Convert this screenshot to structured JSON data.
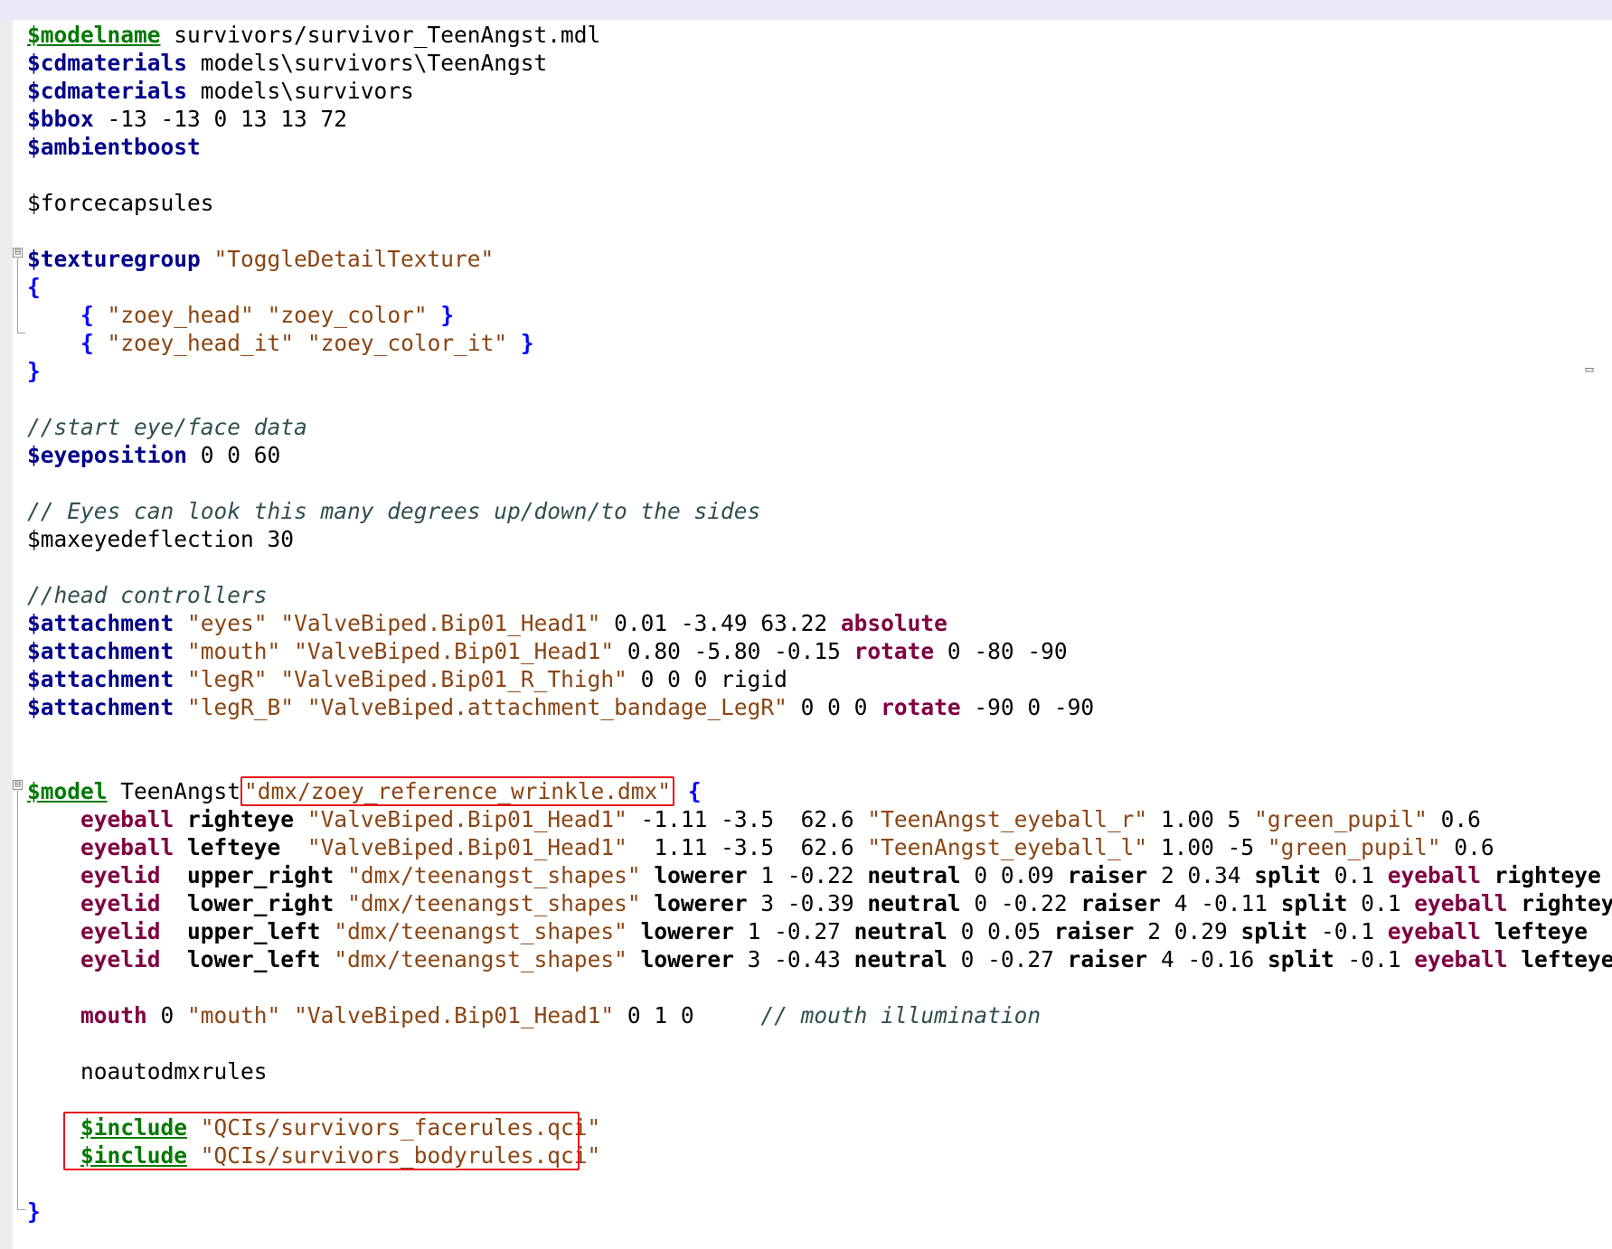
{
  "editor": {
    "lines": [
      [
        {
          "t": "$modelname",
          "c": "kwg"
        },
        {
          "t": " survivors/survivor_TeenAngst.mdl",
          "c": "plain"
        }
      ],
      [
        {
          "t": "$cdmaterials",
          "c": "kw"
        },
        {
          "t": " models\\survivors\\TeenAngst",
          "c": "plain"
        }
      ],
      [
        {
          "t": "$cdmaterials",
          "c": "kw"
        },
        {
          "t": " models\\survivors",
          "c": "plain"
        }
      ],
      [
        {
          "t": "$bbox",
          "c": "kw"
        },
        {
          "t": " -13 -13 0 13 13 72",
          "c": "plain"
        }
      ],
      [
        {
          "t": "$ambientboost",
          "c": "kw"
        }
      ],
      [],
      [
        {
          "t": "$forcecapsules",
          "c": "plain"
        }
      ],
      [],
      [
        {
          "t": "$texturegroup",
          "c": "kw"
        },
        {
          "t": " ",
          "c": "plain"
        },
        {
          "t": "\"ToggleDetailTexture\"",
          "c": "str"
        }
      ],
      [
        {
          "t": "{",
          "c": "br"
        }
      ],
      [
        {
          "t": "    ",
          "c": "plain"
        },
        {
          "t": "{",
          "c": "br"
        },
        {
          "t": " ",
          "c": "plain"
        },
        {
          "t": "\"zoey_head\"",
          "c": "str"
        },
        {
          "t": " ",
          "c": "plain"
        },
        {
          "t": "\"zoey_color\"",
          "c": "str"
        },
        {
          "t": " ",
          "c": "plain"
        },
        {
          "t": "}",
          "c": "br"
        }
      ],
      [
        {
          "t": "    ",
          "c": "plain"
        },
        {
          "t": "{",
          "c": "br"
        },
        {
          "t": " ",
          "c": "plain"
        },
        {
          "t": "\"zoey_head_it\"",
          "c": "str"
        },
        {
          "t": " ",
          "c": "plain"
        },
        {
          "t": "\"zoey_color_it\"",
          "c": "str"
        },
        {
          "t": " ",
          "c": "plain"
        },
        {
          "t": "}",
          "c": "br"
        }
      ],
      [
        {
          "t": "}",
          "c": "br"
        }
      ],
      [],
      [
        {
          "t": "//start eye/face data",
          "c": "cm"
        }
      ],
      [
        {
          "t": "$eyeposition",
          "c": "kw"
        },
        {
          "t": " 0 0 60",
          "c": "plain"
        }
      ],
      [],
      [
        {
          "t": "// Eyes can look this many degrees up/down/to the sides",
          "c": "cm"
        }
      ],
      [
        {
          "t": "$maxeyedeflection 30",
          "c": "plain"
        }
      ],
      [],
      [
        {
          "t": "//head controllers",
          "c": "cm"
        }
      ],
      [
        {
          "t": "$attachment",
          "c": "kw"
        },
        {
          "t": " ",
          "c": "plain"
        },
        {
          "t": "\"eyes\"",
          "c": "str"
        },
        {
          "t": " ",
          "c": "plain"
        },
        {
          "t": "\"ValveBiped.Bip01_Head1\"",
          "c": "str"
        },
        {
          "t": " 0.01 -3.49 63.22 ",
          "c": "plain"
        },
        {
          "t": "absolute",
          "c": "op"
        }
      ],
      [
        {
          "t": "$attachment",
          "c": "kw"
        },
        {
          "t": " ",
          "c": "plain"
        },
        {
          "t": "\"mouth\"",
          "c": "str"
        },
        {
          "t": " ",
          "c": "plain"
        },
        {
          "t": "\"ValveBiped.Bip01_Head1\"",
          "c": "str"
        },
        {
          "t": " 0.80 -5.80 -0.15 ",
          "c": "plain"
        },
        {
          "t": "rotate",
          "c": "op"
        },
        {
          "t": " 0 -80 -90",
          "c": "plain"
        }
      ],
      [
        {
          "t": "$attachment",
          "c": "kw"
        },
        {
          "t": " ",
          "c": "plain"
        },
        {
          "t": "\"legR\"",
          "c": "str"
        },
        {
          "t": " ",
          "c": "plain"
        },
        {
          "t": "\"ValveBiped.Bip01_R_Thigh\"",
          "c": "str"
        },
        {
          "t": " 0 0 0 rigid",
          "c": "plain"
        }
      ],
      [
        {
          "t": "$attachment",
          "c": "kw"
        },
        {
          "t": " ",
          "c": "plain"
        },
        {
          "t": "\"legR_B\"",
          "c": "str"
        },
        {
          "t": " ",
          "c": "plain"
        },
        {
          "t": "\"ValveBiped.attachment_bandage_LegR\"",
          "c": "str"
        },
        {
          "t": " 0 0 0 ",
          "c": "plain"
        },
        {
          "t": "rotate",
          "c": "op"
        },
        {
          "t": " -90 0 -90",
          "c": "plain"
        }
      ],
      [],
      [],
      [
        {
          "t": "$model",
          "c": "kwg"
        },
        {
          "t": " TeenAngst",
          "c": "plain"
        },
        {
          "t": "\"dmx/zoey_reference_wrinkle.dmx\"",
          "c": "str",
          "hl": true
        },
        {
          "t": " ",
          "c": "plain"
        },
        {
          "t": "{",
          "c": "br"
        }
      ],
      [
        {
          "t": "    ",
          "c": "plain"
        },
        {
          "t": "eyeball",
          "c": "op"
        },
        {
          "t": " ",
          "c": "plain"
        },
        {
          "t": "righteye",
          "c": "plain",
          "b": true
        },
        {
          "t": " ",
          "c": "plain"
        },
        {
          "t": "\"ValveBiped.Bip01_Head1\"",
          "c": "str"
        },
        {
          "t": " -1.11 -3.5  62.6 ",
          "c": "plain"
        },
        {
          "t": "\"TeenAngst_eyeball_r\"",
          "c": "str"
        },
        {
          "t": " 1.00 5 ",
          "c": "plain"
        },
        {
          "t": "\"green_pupil\"",
          "c": "str"
        },
        {
          "t": " 0.6",
          "c": "plain"
        }
      ],
      [
        {
          "t": "    ",
          "c": "plain"
        },
        {
          "t": "eyeball",
          "c": "op"
        },
        {
          "t": " ",
          "c": "plain"
        },
        {
          "t": "lefteye",
          "c": "plain",
          "b": true
        },
        {
          "t": "  ",
          "c": "plain"
        },
        {
          "t": "\"ValveBiped.Bip01_Head1\"",
          "c": "str"
        },
        {
          "t": "  1.11 -3.5  62.6 ",
          "c": "plain"
        },
        {
          "t": "\"TeenAngst_eyeball_l\"",
          "c": "str"
        },
        {
          "t": " 1.00 -5 ",
          "c": "plain"
        },
        {
          "t": "\"green_pupil\"",
          "c": "str"
        },
        {
          "t": " 0.6",
          "c": "plain"
        }
      ],
      [
        {
          "t": "    ",
          "c": "plain"
        },
        {
          "t": "eyelid",
          "c": "op"
        },
        {
          "t": "  ",
          "c": "plain"
        },
        {
          "t": "upper_right",
          "c": "plain",
          "b": true
        },
        {
          "t": " ",
          "c": "plain"
        },
        {
          "t": "\"dmx/teenangst_shapes\"",
          "c": "str"
        },
        {
          "t": " ",
          "c": "plain"
        },
        {
          "t": "lowerer",
          "c": "plain",
          "b": true
        },
        {
          "t": " 1 -0.22 ",
          "c": "plain"
        },
        {
          "t": "neutral",
          "c": "plain",
          "b": true
        },
        {
          "t": " 0 0.09 ",
          "c": "plain"
        },
        {
          "t": "raiser",
          "c": "plain",
          "b": true
        },
        {
          "t": " 2 0.34 ",
          "c": "plain"
        },
        {
          "t": "split",
          "c": "plain",
          "b": true
        },
        {
          "t": " 0.1 ",
          "c": "plain"
        },
        {
          "t": "eyeball",
          "c": "op"
        },
        {
          "t": " ",
          "c": "plain"
        },
        {
          "t": "righteye",
          "c": "plain",
          "b": true
        }
      ],
      [
        {
          "t": "    ",
          "c": "plain"
        },
        {
          "t": "eyelid",
          "c": "op"
        },
        {
          "t": "  ",
          "c": "plain"
        },
        {
          "t": "lower_right",
          "c": "plain",
          "b": true
        },
        {
          "t": " ",
          "c": "plain"
        },
        {
          "t": "\"dmx/teenangst_shapes\"",
          "c": "str"
        },
        {
          "t": " ",
          "c": "plain"
        },
        {
          "t": "lowerer",
          "c": "plain",
          "b": true
        },
        {
          "t": " 3 -0.39 ",
          "c": "plain"
        },
        {
          "t": "neutral",
          "c": "plain",
          "b": true
        },
        {
          "t": " 0 -0.22 ",
          "c": "plain"
        },
        {
          "t": "raiser",
          "c": "plain",
          "b": true
        },
        {
          "t": " 4 -0.11 ",
          "c": "plain"
        },
        {
          "t": "split",
          "c": "plain",
          "b": true
        },
        {
          "t": " 0.1 ",
          "c": "plain"
        },
        {
          "t": "eyeball",
          "c": "op"
        },
        {
          "t": " ",
          "c": "plain"
        },
        {
          "t": "righteye",
          "c": "plain",
          "b": true
        }
      ],
      [
        {
          "t": "    ",
          "c": "plain"
        },
        {
          "t": "eyelid",
          "c": "op"
        },
        {
          "t": "  ",
          "c": "plain"
        },
        {
          "t": "upper_left",
          "c": "plain",
          "b": true
        },
        {
          "t": " ",
          "c": "plain"
        },
        {
          "t": "\"dmx/teenangst_shapes\"",
          "c": "str"
        },
        {
          "t": " ",
          "c": "plain"
        },
        {
          "t": "lowerer",
          "c": "plain",
          "b": true
        },
        {
          "t": " 1 -0.27 ",
          "c": "plain"
        },
        {
          "t": "neutral",
          "c": "plain",
          "b": true
        },
        {
          "t": " 0 0.05 ",
          "c": "plain"
        },
        {
          "t": "raiser",
          "c": "plain",
          "b": true
        },
        {
          "t": " 2 0.29 ",
          "c": "plain"
        },
        {
          "t": "split",
          "c": "plain",
          "b": true
        },
        {
          "t": " -0.1 ",
          "c": "plain"
        },
        {
          "t": "eyeball",
          "c": "op"
        },
        {
          "t": " ",
          "c": "plain"
        },
        {
          "t": "lefteye",
          "c": "plain",
          "b": true
        }
      ],
      [
        {
          "t": "    ",
          "c": "plain"
        },
        {
          "t": "eyelid",
          "c": "op"
        },
        {
          "t": "  ",
          "c": "plain"
        },
        {
          "t": "lower_left",
          "c": "plain",
          "b": true
        },
        {
          "t": " ",
          "c": "plain"
        },
        {
          "t": "\"dmx/teenangst_shapes\"",
          "c": "str"
        },
        {
          "t": " ",
          "c": "plain"
        },
        {
          "t": "lowerer",
          "c": "plain",
          "b": true
        },
        {
          "t": " 3 -0.43 ",
          "c": "plain"
        },
        {
          "t": "neutral",
          "c": "plain",
          "b": true
        },
        {
          "t": " 0 -0.27 ",
          "c": "plain"
        },
        {
          "t": "raiser",
          "c": "plain",
          "b": true
        },
        {
          "t": " 4 -0.16 ",
          "c": "plain"
        },
        {
          "t": "split",
          "c": "plain",
          "b": true
        },
        {
          "t": " -0.1 ",
          "c": "plain"
        },
        {
          "t": "eyeball",
          "c": "op"
        },
        {
          "t": " ",
          "c": "plain"
        },
        {
          "t": "lefteye",
          "c": "plain",
          "b": true
        }
      ],
      [],
      [
        {
          "t": "    ",
          "c": "plain"
        },
        {
          "t": "mouth",
          "c": "op"
        },
        {
          "t": " 0 ",
          "c": "plain"
        },
        {
          "t": "\"mouth\"",
          "c": "str"
        },
        {
          "t": " ",
          "c": "plain"
        },
        {
          "t": "\"ValveBiped.Bip01_Head1\"",
          "c": "str"
        },
        {
          "t": " 0 1 0     ",
          "c": "plain"
        },
        {
          "t": "// mouth illumination",
          "c": "cm"
        }
      ],
      [],
      [
        {
          "t": "    noautodmxrules",
          "c": "plain"
        }
      ],
      [],
      [
        {
          "t": "    ",
          "c": "plain"
        },
        {
          "t": "$include",
          "c": "kwg"
        },
        {
          "t": " ",
          "c": "plain"
        },
        {
          "t": "\"QCIs/survivors_facerules.qci\"",
          "c": "str"
        }
      ],
      [
        {
          "t": "    ",
          "c": "plain"
        },
        {
          "t": "$include",
          "c": "kwg"
        },
        {
          "t": " ",
          "c": "plain"
        },
        {
          "t": "\"QCIs/survivors_bodyrules.qci\"",
          "c": "str"
        }
      ],
      [],
      [
        {
          "t": "}",
          "c": "br"
        }
      ]
    ],
    "fold_markers": [
      "⊟",
      "⊟"
    ],
    "side_icon": "▭"
  },
  "colors": {
    "keyword": "#00008b",
    "keyword_underlined": "#007a00",
    "string": "#8b4513",
    "comment": "#2f4f4f",
    "brace": "#0000ff",
    "option": "#800040",
    "highlight_box": "#e8141c",
    "top_bar": "#e8e8f7"
  }
}
